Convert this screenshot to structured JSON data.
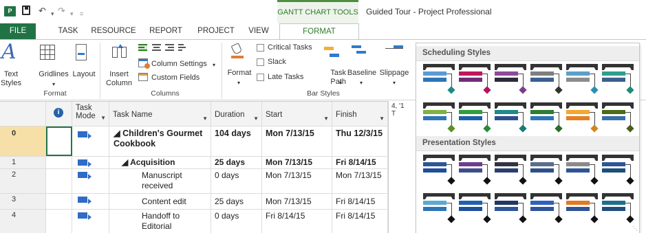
{
  "window": {
    "app_icon": "P",
    "contextual_tab_group": "GANTT CHART TOOLS",
    "doc_title": "Guided Tour - Project Professional"
  },
  "quick_access": {
    "save_icon": "save-icon",
    "undo_glyph": "↶",
    "redo_glyph": "↷",
    "dropdown_glyph": "▾",
    "customize_glyph": "="
  },
  "tabs": [
    "FILE",
    "TASK",
    "RESOURCE",
    "REPORT",
    "PROJECT",
    "VIEW",
    "FORMAT"
  ],
  "ribbon": {
    "format_group": {
      "label": "Format",
      "text_styles": "Text\nStyles",
      "gridlines": "Gridlines",
      "layout": "Layout"
    },
    "columns_group": {
      "label": "Columns",
      "insert_column": "Insert\nColumn",
      "column_settings": "Column Settings",
      "custom_fields": "Custom Fields"
    },
    "bar_styles_group": {
      "label": "Bar Styles",
      "format": "Format",
      "critical_tasks": "Critical Tasks",
      "slack": "Slack",
      "late_tasks": "Late Tasks",
      "task_path": "Task\nPath",
      "baseline": "Baseline",
      "slippage": "Slippage"
    }
  },
  "table": {
    "headers": {
      "info": "i",
      "task_mode": "Task\nMode",
      "task_name": "Task Name",
      "duration": "Duration",
      "start": "Start",
      "finish": "Finish"
    },
    "rows": [
      {
        "num": "0",
        "name": "◢ Children's Gourmet Cookbook",
        "duration": "104 days",
        "start": "Mon 7/13/15",
        "finish": "Thu 12/3/15"
      },
      {
        "num": "1",
        "name": "◢ Acquisition",
        "duration": "25 days",
        "start": "Mon 7/13/15",
        "finish": "Fri 8/14/15"
      },
      {
        "num": "2",
        "name": "Manuscript received",
        "duration": "0 days",
        "start": "Mon 7/13/15",
        "finish": "Mon 7/13/15"
      },
      {
        "num": "3",
        "name": "Content edit",
        "duration": "25 days",
        "start": "Mon 7/13/15",
        "finish": "Fri 8/14/15"
      },
      {
        "num": "4",
        "name": "Handoff to Editorial",
        "duration": "0 days",
        "start": "Fri 8/14/15",
        "finish": "Fri 8/14/15"
      }
    ]
  },
  "gantt_header": "4, '1\nT",
  "gallery": {
    "scheduling_title": "Scheduling Styles",
    "presentation_title": "Presentation Styles",
    "scheduling_styles": [
      {
        "b1": "#5b9bd5",
        "b2": "#2e75b6",
        "dia": "#1e8a8a"
      },
      {
        "b1": "#c0185b",
        "b2": "#6f2d77",
        "dia": "#b3165a"
      },
      {
        "b1": "#8e4a9b",
        "b2": "#2b2b3c",
        "dia": "#7b3b8c"
      },
      {
        "b1": "#7f7f7f",
        "b2": "#3a5f91",
        "dia": "#333333"
      },
      {
        "b1": "#5aa0c8",
        "b2": "#8c8c8c",
        "dia": "#2a8fb5"
      },
      {
        "b1": "#2e9e8e",
        "b2": "#3d5f8e",
        "dia": "#1f8a7a"
      },
      {
        "b1": "#7cb342",
        "b2": "#2e75b6",
        "dia": "#5d8f2b"
      },
      {
        "b1": "#2e9e3e",
        "b2": "#1f5fa8",
        "dia": "#2a8a3a"
      },
      {
        "b1": "#1f8a8a",
        "b2": "#2e4e8e",
        "dia": "#1a7a7a"
      },
      {
        "b1": "#2e7d32",
        "b2": "#2e75b6",
        "dia": "#2a6b2e"
      },
      {
        "b1": "#f0a830",
        "b2": "#e67e22",
        "dia": "#d4861a"
      },
      {
        "b1": "#4e6b1a",
        "b2": "#3b6fa8",
        "dia": "#4a5f1a"
      }
    ],
    "presentation_styles": [
      {
        "b1": "#2f5597",
        "b2": "#1f4e9a",
        "dia": "#111111"
      },
      {
        "b1": "#6f3c8e",
        "b2": "#3f4e8a",
        "dia": "#111111"
      },
      {
        "b1": "#333344",
        "b2": "#2b3f6e",
        "dia": "#111111"
      },
      {
        "b1": "#5a6e8e",
        "b2": "#2f4f8a",
        "dia": "#111111"
      },
      {
        "b1": "#8a8a8a",
        "b2": "#2f5597",
        "dia": "#111111"
      },
      {
        "b1": "#2f5597",
        "b2": "#1f4e79",
        "dia": "#111111"
      },
      {
        "b1": "#5aaad0",
        "b2": "#2e75b6",
        "dia": "#111111"
      },
      {
        "b1": "#2060b0",
        "b2": "#1f4e9a",
        "dia": "#111111"
      },
      {
        "b1": "#203864",
        "b2": "#2f5597",
        "dia": "#111111"
      },
      {
        "b1": "#3060c0",
        "b2": "#2f5597",
        "dia": "#111111"
      },
      {
        "b1": "#e07b24",
        "b2": "#2f5597",
        "dia": "#111111"
      },
      {
        "b1": "#1f6f8b",
        "b2": "#204e7a",
        "dia": "#111111"
      }
    ]
  }
}
